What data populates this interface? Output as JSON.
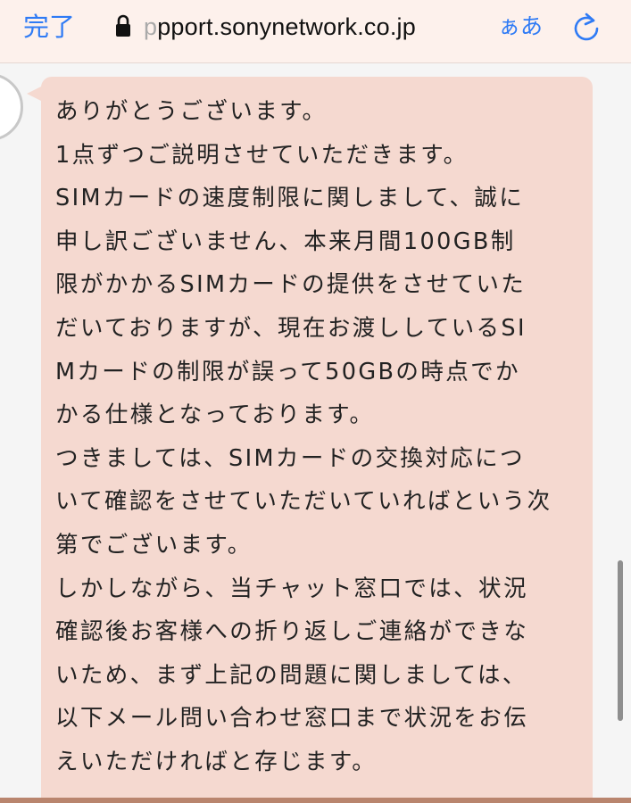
{
  "browser": {
    "done_label": "完了",
    "url_faded": "p",
    "url": "pport.sonynetwork.co.jp",
    "text_size_label": "ぁあ",
    "accent_color": "#2f7bf5"
  },
  "chat": {
    "bubble_color": "#f5d9d0",
    "lines": [
      "ありがとうございます。",
      "1点ずつご説明させていただきます。",
      "SIMカードの速度制限に関しまして、誠に",
      "申し訳ございません、本来月間100GB制",
      "限がかかるSIMカードの提供をさせていた",
      "だいておりますが、現在お渡ししているSI",
      "Mカードの制限が誤って50GBの時点でか",
      "かる仕様となっております。",
      "つきましては、SIMカードの交換対応につ",
      "いて確認をさせていただいていればという次",
      "第でございます。",
      "しかしながら、当チャット窓口では、状況",
      "確認後お客様への折り返しご連絡ができな",
      "いため、まず上記の問題に関しましては、",
      "以下メール問い合わせ窓口まで状況をお伝",
      "えいただければと存じます。"
    ]
  }
}
